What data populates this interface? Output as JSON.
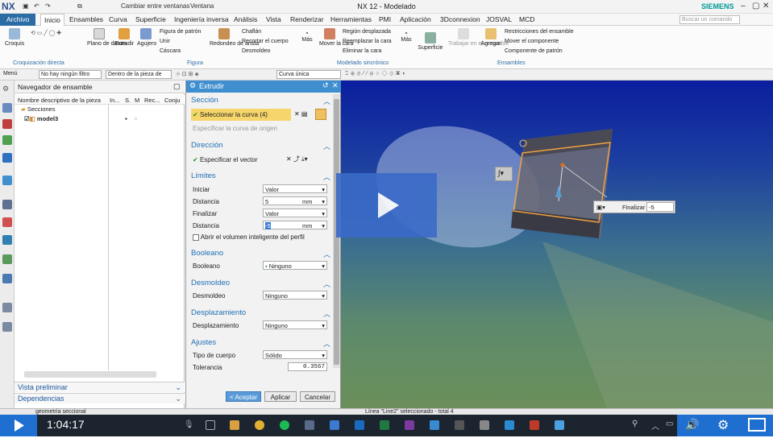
{
  "titlebar": {
    "logo": "NX",
    "quick": "Cambiar entre ventanas",
    "ventana": "Ventana",
    "title": "NX 12 - Modelado",
    "brand": "SIEMENS"
  },
  "tabs": [
    "Archivo",
    "Inicio",
    "Ensambles",
    "Curva",
    "Superficie",
    "Ingeniería inversa",
    "Análisis",
    "Vista",
    "Renderizar",
    "Herramientas",
    "PMI",
    "Aplicación",
    "3Dconnexion",
    "JOSVAL",
    "MCD"
  ],
  "search_placeholder": "Buscar un comando",
  "ribbon": {
    "croquis": "Croquis",
    "plano": "Plano de datum",
    "extrudir": "Extrudir",
    "agujero": "Agujero",
    "figura_patron": "Figura de patrón",
    "unir": "Unir",
    "cascara": "Cáscara",
    "redondeo": "Redondeo de arista",
    "chaflan": "Chaflán",
    "recortar": "Recortar el cuerpo",
    "desmoldeo": "Desmoldeo",
    "mas": "Más",
    "mover_cara": "Mover la cara",
    "region": "Región desplazada",
    "reemplazar": "Reemplazar la cara",
    "eliminar": "Eliminar la cara",
    "mas2": "Más",
    "superficie": "Superficie",
    "trabajar": "Trabajar en el ensamble",
    "agregar": "Agregar",
    "restricciones": "Restricciones del ensamble",
    "mover_comp": "Mover el componente",
    "componente_patron": "Componente de patrón",
    "groups": {
      "croquizacion": "Croquización directa",
      "figura": "Figura",
      "modelado": "Modelado sincrónico",
      "ensambles": "Ensambles"
    }
  },
  "toolbar2": {
    "menu": "Menú",
    "filtro": "No hay ningún filtro",
    "dentro": "Dentro de la pieza de",
    "curva": "Curva única"
  },
  "navigator": {
    "title": "Navegador de ensamble",
    "columns": [
      "Nombre descriptivo de la pieza",
      "In...",
      "S.",
      "M",
      "Rec...",
      "Conju"
    ],
    "items": [
      {
        "label": "Secciones"
      },
      {
        "label": "model3"
      }
    ],
    "preview": "Vista preliminar",
    "deps": "Dependencias"
  },
  "dialog": {
    "title": "Extrudir",
    "seccion": "Sección",
    "sel_curva": "Seleccionar la curva (4)",
    "esp_curva": "Especificar la curva de origen",
    "direccion": "Dirección",
    "esp_vector": "Especificar el vector",
    "limites": "Límites",
    "iniciar": "Iniciar",
    "iniciar_val": "Valor",
    "distancia": "Distancia",
    "dist1": "5",
    "unit": "mm",
    "finalizar": "Finalizar",
    "finalizar_val": "Valor",
    "dist2": "-5",
    "abrir": "Abrir el volumen inteligente del perfil",
    "booleano_sec": "Booleano",
    "booleano": "Booleano",
    "booleano_val": "Ninguno",
    "desmoldeo_sec": "Desmoldeo",
    "desmoldeo": "Desmoldeo",
    "desmoldeo_val": "Ninguno",
    "desplazamiento_sec": "Desplazamiento",
    "desplazamiento": "Desplazamiento",
    "desplazamiento_val": "Ninguno",
    "ajustes": "Ajustes",
    "tipo_cuerpo": "Tipo de cuerpo",
    "tipo_val": "Sólido",
    "tolerancia": "Tolerancia",
    "tol_val": "0.3567",
    "aceptar": "< Aceptar >",
    "aplicar": "Aplicar",
    "cancelar": "Cancelar"
  },
  "viewport": {
    "finalizar_label": "Finalizar",
    "finalizar_val": "-5"
  },
  "status": {
    "left": "geometría seccional",
    "right": "Línea \"Line2\" seleccionado - total 4"
  },
  "player": {
    "time": "1:04:17"
  }
}
